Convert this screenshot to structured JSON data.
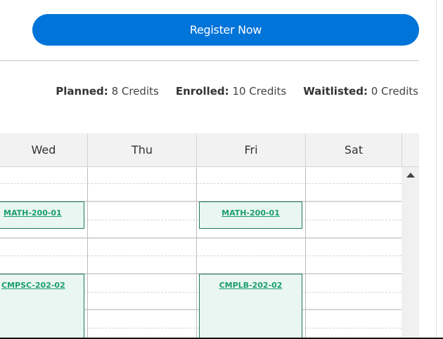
{
  "actions": {
    "register_label": "Register Now"
  },
  "credits": {
    "planned_label": "Planned:",
    "planned_value": "8 Credits",
    "enrolled_label": "Enrolled:",
    "enrolled_value": "10 Credits",
    "waitlisted_label": "Waitlisted:",
    "waitlisted_value": "0 Credits"
  },
  "calendar": {
    "days": [
      "Wed",
      "Thu",
      "Fri",
      "Sat"
    ],
    "events": [
      {
        "day": "Wed",
        "course": "MATH-200-01"
      },
      {
        "day": "Fri",
        "course": "MATH-200-01"
      },
      {
        "day": "Wed",
        "course": "CMPSC-202-02"
      },
      {
        "day": "Fri",
        "course": "CMPLB-202-02"
      }
    ]
  },
  "colors": {
    "accent": "#0074d9",
    "event_border": "#1e7a56",
    "event_text": "#1a9e6a",
    "event_bg": "#e9f6f1"
  }
}
